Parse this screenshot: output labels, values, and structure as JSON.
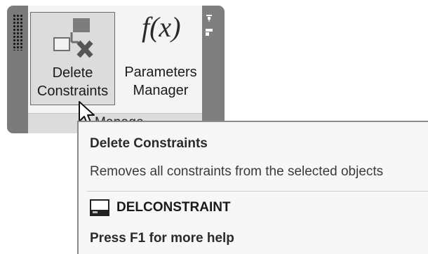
{
  "ribbon_panel": {
    "title": "Manage",
    "buttons": [
      {
        "label_line1": "Delete",
        "label_line2": "Constraints",
        "icon": "delete-constraints-icon"
      },
      {
        "label_line1": "Parameters",
        "label_line2": "Manager",
        "icon": "function-fx-icon",
        "icon_text": "f(x)"
      }
    ]
  },
  "tooltip": {
    "title": "Delete Constraints",
    "description": "Removes all constraints from the selected objects",
    "command": "DELCONSTRAINT",
    "command_icon": "command-line-icon",
    "help": "Press F1 for more help"
  }
}
